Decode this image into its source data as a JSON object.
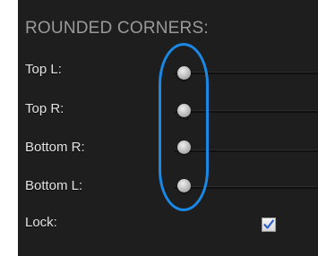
{
  "panel": {
    "title": "ROUNDED CORNERS:"
  },
  "corners": [
    {
      "label": "Top L:"
    },
    {
      "label": "Top R:"
    },
    {
      "label": "Bottom R:"
    },
    {
      "label": "Bottom L:"
    }
  ],
  "lock": {
    "label": "Lock:",
    "checked": true
  },
  "colors": {
    "panel_bg": "#1e1e1e",
    "title_text": "#9a9a9a",
    "label_text": "#e4e4e4",
    "highlight": "#1b88e6",
    "check_mark": "#2a5fd0"
  }
}
